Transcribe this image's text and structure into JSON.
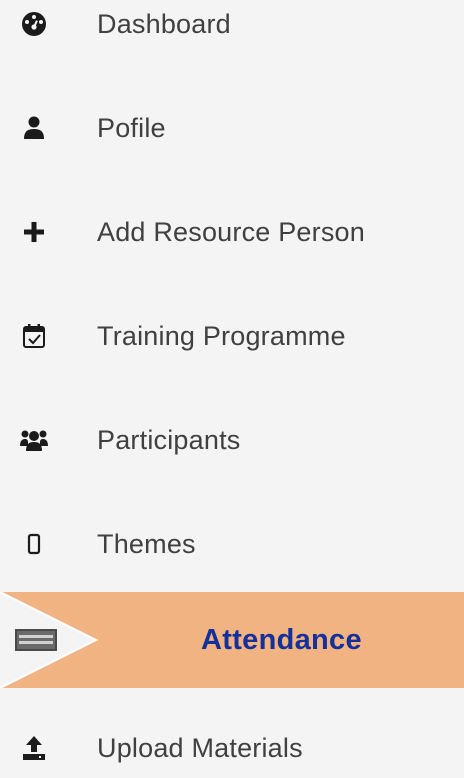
{
  "menu": {
    "items": [
      {
        "label": "Dashboard",
        "icon": "tachometer-icon"
      },
      {
        "label": "Pofile",
        "icon": "user-icon"
      },
      {
        "label": "Add Resource Person",
        "icon": "plus-icon"
      },
      {
        "label": "Training Programme",
        "icon": "calendar-check-icon"
      },
      {
        "label": "Participants",
        "icon": "users-icon"
      },
      {
        "label": "Themes",
        "icon": "mobile-icon"
      },
      {
        "label": "Attendance",
        "icon": "credit-card-icon",
        "active": true
      },
      {
        "label": "Upload Materials",
        "icon": "upload-icon"
      }
    ]
  },
  "colors": {
    "background": "#f4f4f4",
    "active_bg": "#f2b383",
    "active_text": "#14309a",
    "label_text": "#404040",
    "icon": "#1b1b1b"
  }
}
